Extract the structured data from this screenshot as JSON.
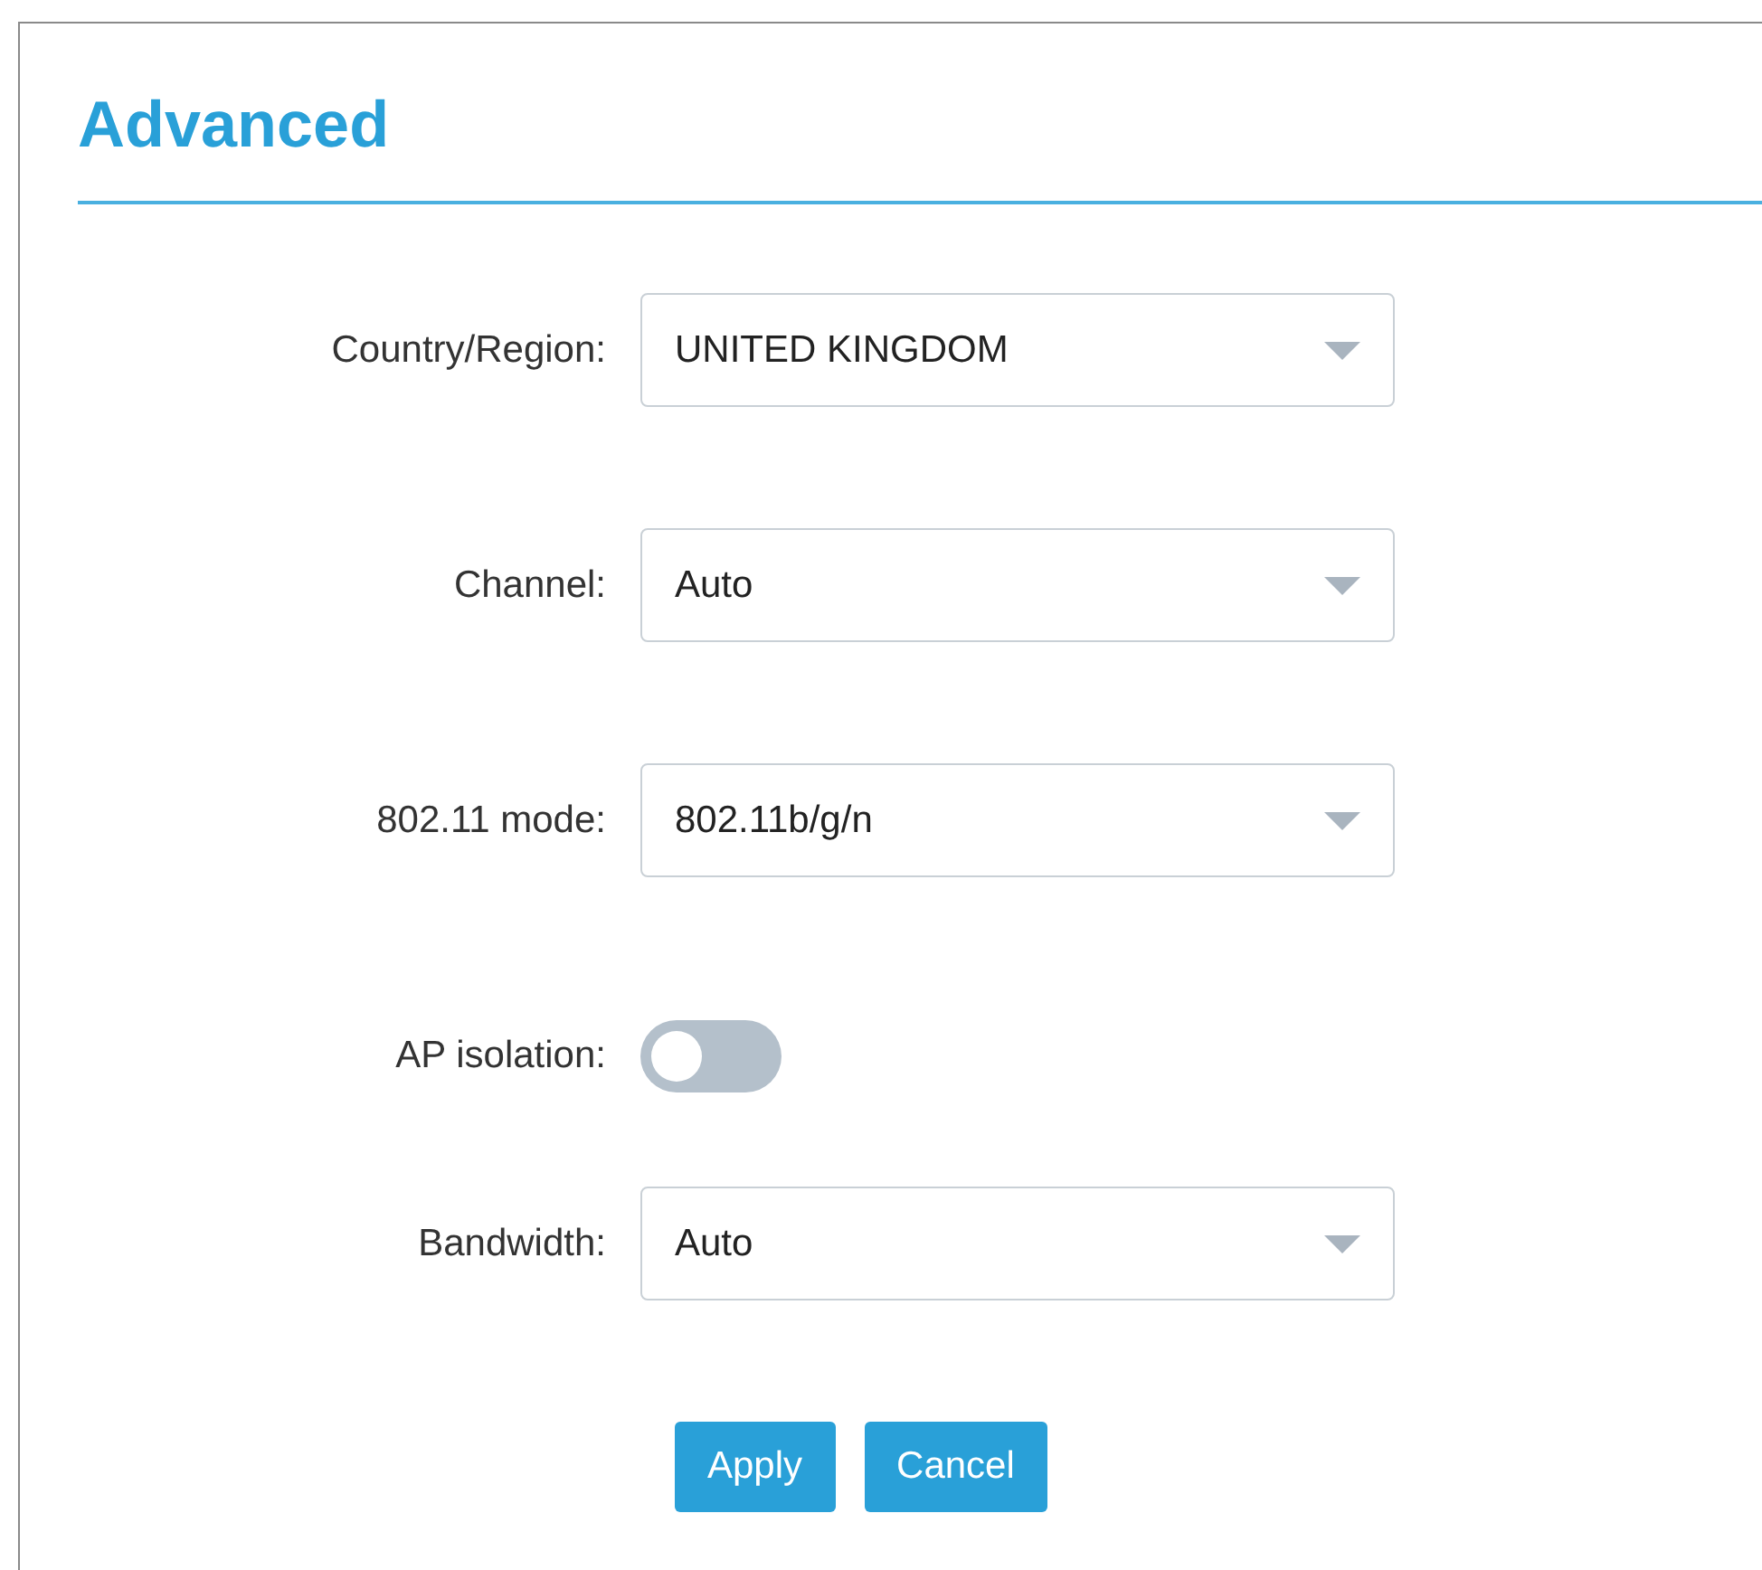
{
  "title": "Advanced",
  "fields": [
    {
      "kind": "select",
      "label": "Country/Region:",
      "value": "UNITED KINGDOM"
    },
    {
      "kind": "select",
      "label": "Channel:",
      "value": "Auto"
    },
    {
      "kind": "select",
      "label": "802.11 mode:",
      "value": "802.11b/g/n"
    },
    {
      "kind": "toggle",
      "label": "AP isolation:",
      "on": false
    },
    {
      "kind": "select",
      "label": "Bandwidth:",
      "value": "Auto"
    }
  ],
  "buttons": [
    "Apply",
    "Cancel"
  ]
}
